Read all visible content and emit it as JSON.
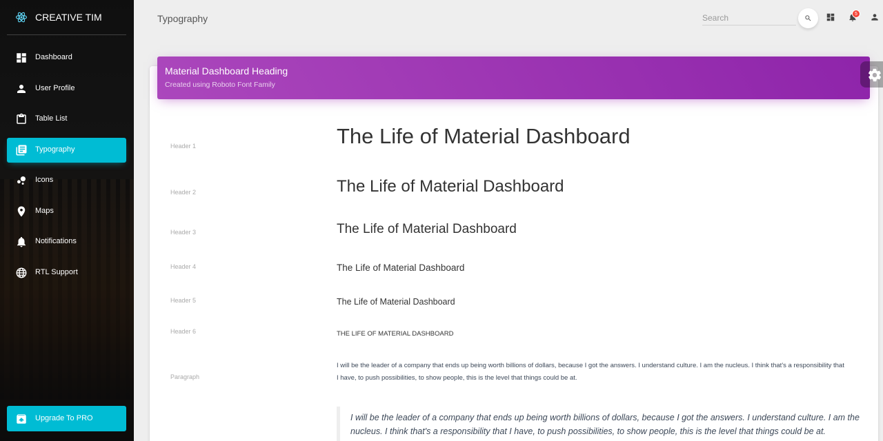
{
  "brand": {
    "name": "CREATIVE TIM",
    "icon": "react-atom-icon"
  },
  "sidebar": {
    "items": [
      {
        "label": "Dashboard",
        "icon": "dashboard-icon",
        "active": false
      },
      {
        "label": "User Profile",
        "icon": "person-icon",
        "active": false
      },
      {
        "label": "Table List",
        "icon": "clipboard-icon",
        "active": false
      },
      {
        "label": "Typography",
        "icon": "library-books-icon",
        "active": true
      },
      {
        "label": "Icons",
        "icon": "bubble-chart-icon",
        "active": false
      },
      {
        "label": "Maps",
        "icon": "location-pin-icon",
        "active": false
      },
      {
        "label": "Notifications",
        "icon": "bell-icon",
        "active": false
      },
      {
        "label": "RTL Support",
        "icon": "language-icon",
        "active": false
      }
    ],
    "upgrade": {
      "label": "Upgrade To PRO",
      "icon": "unarchive-icon"
    },
    "active_color": "#00bcd4"
  },
  "navbar": {
    "title": "Typography",
    "search_placeholder": "Search",
    "notification_count": "5"
  },
  "card": {
    "title": "Material Dashboard Heading",
    "category": "Created using Roboto Font Family",
    "header_color": "#9c27b0"
  },
  "typography": {
    "rows": [
      {
        "label": "Header 1",
        "sample": "The Life of Material Dashboard"
      },
      {
        "label": "Header 2",
        "sample": "The Life of Material Dashboard"
      },
      {
        "label": "Header 3",
        "sample": "The Life of Material Dashboard"
      },
      {
        "label": "Header 4",
        "sample": "The Life of Material Dashboard"
      },
      {
        "label": "Header 5",
        "sample": "The Life of Material Dashboard"
      },
      {
        "label": "Header 6",
        "sample": "The Life of Material Dashboard"
      },
      {
        "label": "Paragraph",
        "sample": "I will be the leader of a company that ends up being worth billions of dollars, because I got the answers. I understand culture. I am the nucleus. I think that's a responsibility that I have, to push possibilities, to show people, this is the level that things could be at."
      }
    ],
    "quote": "I will be the leader of a company that ends up being worth billions of dollars, because I got the answers. I understand culture. I am the nucleus. I think that's a responsibility that I have, to push possibilities, to show people, this is the level that things could be at."
  }
}
